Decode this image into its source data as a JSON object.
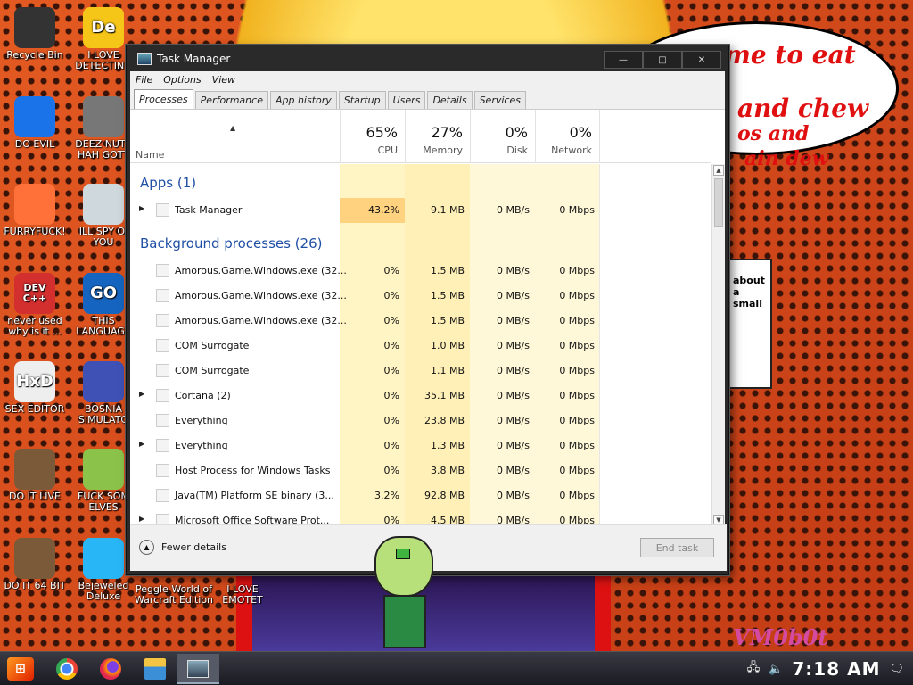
{
  "desktop": {
    "icons": [
      {
        "label": "Recycle Bin",
        "glyph": "helmet-icon",
        "color": "#333333"
      },
      {
        "label": "I LOVE DETECTING",
        "glyph": "De",
        "color": "#f5c518"
      },
      {
        "label": "DO EVIL",
        "glyph": "chrome-icon",
        "color": "#1a73e8"
      },
      {
        "label": "DEEZ NUTS HAH GOTT",
        "glyph": "stack-icon",
        "color": "#777777"
      },
      {
        "label": "FURRYFUCK!",
        "glyph": "firefox-icon",
        "color": "#ff7139"
      },
      {
        "label": "ILL SPY OI YOU",
        "glyph": "spy-icon",
        "color": "#cfd8dc"
      },
      {
        "label": "never used why is it ...",
        "glyph": "DEV C++",
        "color": "#d32f2f"
      },
      {
        "label": "THIS LANGUAGE",
        "glyph": "GO",
        "color": "#1565c0"
      },
      {
        "label": "SEX EDITOR",
        "glyph": "HxD",
        "color": "#eeeeee"
      },
      {
        "label": "BOSNIA SIMULATO",
        "glyph": "mine-icon",
        "color": "#3f51b5"
      },
      {
        "label": "DO IT LIVE",
        "glyph": "portrait-icon",
        "color": "#7b5a3a"
      },
      {
        "label": "FUCK SOM ELVES",
        "glyph": "elf-icon",
        "color": "#8bc34a"
      },
      {
        "label": "DO IT 64 BIT",
        "glyph": "portrait-icon",
        "color": "#7b5a3a"
      },
      {
        "label": "Bejeweled Deluxe",
        "glyph": "gem-icon",
        "color": "#29b6f6"
      }
    ],
    "extra_labels": [
      "Peggle World of Warcraft Edition",
      "I LOVE EMOTET"
    ],
    "speech_bubble": [
      "it's time to eat shit",
      "and chew",
      "os and",
      "ain dew"
    ],
    "side_window_text": "about a small",
    "watermark": "VM0b0t"
  },
  "window": {
    "title": "Task Manager",
    "controls": [
      "—",
      "□",
      "✕"
    ],
    "menu": [
      "File",
      "Options",
      "View"
    ],
    "tabs": [
      "Processes",
      "Performance",
      "App history",
      "Startup",
      "Users",
      "Details",
      "Services"
    ],
    "active_tab": "Processes"
  },
  "table": {
    "name_header": "Name",
    "columns": [
      {
        "pct": "65%",
        "label": "CPU"
      },
      {
        "pct": "27%",
        "label": "Memory"
      },
      {
        "pct": "0%",
        "label": "Disk"
      },
      {
        "pct": "0%",
        "label": "Network"
      }
    ],
    "groups": {
      "apps": "Apps (1)",
      "background": "Background processes (26)"
    },
    "apps": [
      {
        "name": "Task Manager",
        "expand": true,
        "cpu": "43.2%",
        "mem": "9.1 MB",
        "disk": "0 MB/s",
        "net": "0 Mbps"
      }
    ],
    "background": [
      {
        "name": "Amorous.Game.Windows.exe (32...",
        "expand": false,
        "cpu": "0%",
        "mem": "1.5 MB",
        "disk": "0 MB/s",
        "net": "0 Mbps"
      },
      {
        "name": "Amorous.Game.Windows.exe (32...",
        "expand": false,
        "cpu": "0%",
        "mem": "1.5 MB",
        "disk": "0 MB/s",
        "net": "0 Mbps"
      },
      {
        "name": "Amorous.Game.Windows.exe (32...",
        "expand": false,
        "cpu": "0%",
        "mem": "1.5 MB",
        "disk": "0 MB/s",
        "net": "0 Mbps"
      },
      {
        "name": "COM Surrogate",
        "expand": false,
        "cpu": "0%",
        "mem": "1.0 MB",
        "disk": "0 MB/s",
        "net": "0 Mbps"
      },
      {
        "name": "COM Surrogate",
        "expand": false,
        "cpu": "0%",
        "mem": "1.1 MB",
        "disk": "0 MB/s",
        "net": "0 Mbps"
      },
      {
        "name": "Cortana (2)",
        "expand": true,
        "cpu": "0%",
        "mem": "35.1 MB",
        "disk": "0 MB/s",
        "net": "0 Mbps"
      },
      {
        "name": "Everything",
        "expand": false,
        "cpu": "0%",
        "mem": "23.8 MB",
        "disk": "0 MB/s",
        "net": "0 Mbps"
      },
      {
        "name": "Everything",
        "expand": true,
        "cpu": "0%",
        "mem": "1.3 MB",
        "disk": "0 MB/s",
        "net": "0 Mbps"
      },
      {
        "name": "Host Process for Windows Tasks",
        "expand": false,
        "cpu": "0%",
        "mem": "3.8 MB",
        "disk": "0 MB/s",
        "net": "0 Mbps"
      },
      {
        "name": "Java(TM) Platform SE binary (3...",
        "expand": false,
        "cpu": "3.2%",
        "mem": "92.8 MB",
        "disk": "0 MB/s",
        "net": "0 Mbps"
      },
      {
        "name": "Microsoft Office Software Prot...",
        "expand": true,
        "cpu": "0%",
        "mem": "4.5 MB",
        "disk": "0 MB/s",
        "net": "0 Mbps"
      }
    ]
  },
  "footer": {
    "fewer_details": "Fewer details",
    "end_task": "End task"
  },
  "taskbar": {
    "clock": "7:18 AM",
    "pinned": [
      "chrome-icon",
      "firefox-icon",
      "file-explorer-icon"
    ],
    "running": [
      "task-manager-icon"
    ]
  }
}
